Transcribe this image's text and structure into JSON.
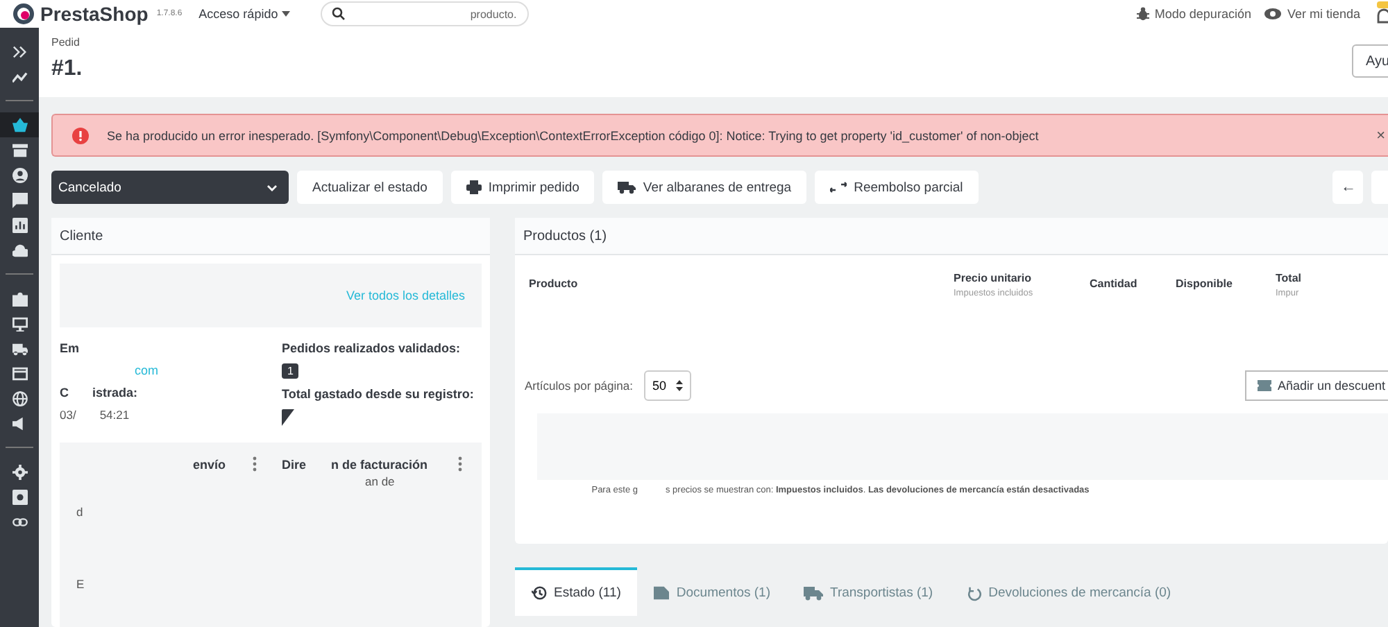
{
  "topbar": {
    "logo": "PrestaShop",
    "version": "1.7.8.6",
    "quick_access": "Acceso rápido",
    "search": {
      "placeholder": "producto."
    },
    "debug": "Modo depuración",
    "view_shop": "Ver mi tienda"
  },
  "sidebar": [
    {
      "kind": "expand",
      "selected": false
    },
    {
      "kind": "chart",
      "selected": false
    },
    {
      "kind": "divider"
    },
    {
      "kind": "basket",
      "selected": true
    },
    {
      "kind": "store",
      "selected": false
    },
    {
      "kind": "user",
      "selected": false
    },
    {
      "kind": "chat",
      "selected": false
    },
    {
      "kind": "stats",
      "selected": false
    },
    {
      "kind": "cloud",
      "selected": false
    },
    {
      "kind": "divider"
    },
    {
      "kind": "puzzle",
      "selected": false
    },
    {
      "kind": "monitor",
      "selected": false
    },
    {
      "kind": "truck",
      "selected": false
    },
    {
      "kind": "card",
      "selected": false
    },
    {
      "kind": "globe",
      "selected": false
    },
    {
      "kind": "megaphone",
      "selected": false
    },
    {
      "kind": "divider"
    },
    {
      "kind": "gear",
      "selected": false
    },
    {
      "kind": "gearbox",
      "selected": false
    },
    {
      "kind": "link",
      "selected": false
    }
  ],
  "header": {
    "breadcrumb": "Pedid",
    "title": "#1.",
    "help": "Ayu"
  },
  "alert": {
    "message": "Se ha producido un error inesperado. [Symfony\\Component\\Debug\\Exception\\ContextErrorException código 0]: Notice: Trying to get property 'id_customer' of non-object",
    "close": "×"
  },
  "actions": {
    "status": "Cancelado",
    "buttons": [
      {
        "kind": "plain",
        "label": "Actualizar el estado"
      },
      {
        "kind": "print",
        "label": "Imprimir pedido"
      },
      {
        "kind": "truck",
        "label": "Ver albaranes de entrega"
      },
      {
        "kind": "refund",
        "label": "Reembolso parcial"
      }
    ],
    "back": "←"
  },
  "customer": {
    "title": "Cliente",
    "details_link": "Ver todos los detalles",
    "email_label": "Em",
    "email_value": "com",
    "registered_label_a": "C",
    "registered_label_b": "istrada:",
    "registered_value_a": "03/",
    "registered_value_b": "54:21",
    "orders_label": "Pedidos realizados validados:",
    "orders_count": "1",
    "spent_label": "Total gastado desde su registro:",
    "shipping_title": "envío",
    "billing_title_a": "Dire",
    "billing_title_b": "n de facturación",
    "billing_line": "an de",
    "shipping_line_a": "d",
    "shipping_line_b": "E"
  },
  "products": {
    "title": "Productos (1)",
    "columns": [
      {
        "label": "Producto"
      },
      {
        "label": "Precio unitario",
        "sub": "Impuestos incluidos"
      },
      {
        "label": "Cantidad"
      },
      {
        "label": "Disponible"
      },
      {
        "label": "Total",
        "sub": "Impur"
      }
    ],
    "per_page_label": "Artículos por página:",
    "per_page": "50",
    "discount": "Añadir un descuent",
    "note_a": "Para este g",
    "note_b": "s precios se muestran con: **Impuestos incluidos**. **Las devoluciones de mercancía están desactivadas**"
  },
  "tabs": [
    {
      "kind": "history",
      "label": "Estado (11)",
      "selected": true
    },
    {
      "kind": "doc",
      "label": "Documentos (1)",
      "selected": false
    },
    {
      "kind": "truck",
      "label": "Transportistas (1)",
      "selected": false
    },
    {
      "kind": "undo",
      "label": "Devoluciones de mercancía (0)",
      "selected": false
    }
  ]
}
